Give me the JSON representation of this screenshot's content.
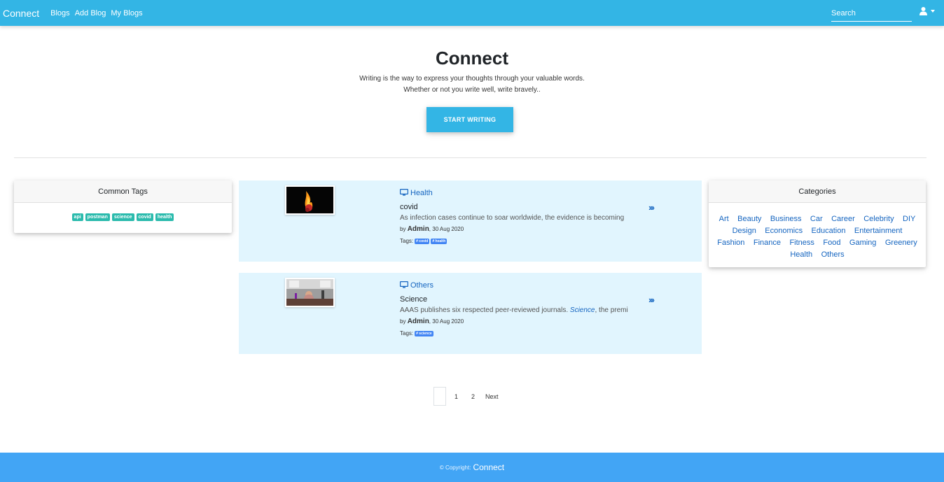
{
  "navbar": {
    "brand": "Connect",
    "links": [
      "Blogs",
      "Add Blog",
      "My Blogs"
    ],
    "search_placeholder": "Search",
    "user_icon": "user-icon",
    "bg_color": "#33b5e5"
  },
  "hero": {
    "title": "Connect",
    "line1": "Writing is the way to express your thoughts through your valuable words.",
    "line2": "Whether or not you write well, write bravely..",
    "button": "START WRITING"
  },
  "common_tags": {
    "header": "Common Tags",
    "tags": [
      "api",
      "postman",
      "science",
      "covid",
      "health"
    ]
  },
  "categories": {
    "header": "Categories",
    "items": [
      "Art",
      "Beauty",
      "Business",
      "Car",
      "Career",
      "Celebrity",
      "DIY",
      "Design",
      "Economics",
      "Education",
      "Entertainment",
      "Fashion",
      "Finance",
      "Fitness",
      "Food",
      "Gaming",
      "Greenery",
      "Health",
      "Others"
    ]
  },
  "blogs": [
    {
      "category": "Health",
      "title": "covid",
      "excerpt": "As infection cases continue to soar worldwide, the evidence is becoming",
      "by": "by",
      "author": "Admin",
      "date": ", 30 Aug 2020",
      "tags_label": "Tags:",
      "tags": [
        "# covid",
        "# health"
      ]
    },
    {
      "category": "Others",
      "title": "Science",
      "excerpt_pre": "AAAS publishes six respected peer-reviewed journals. ",
      "excerpt_em": "Science",
      "excerpt_post": ", the premi",
      "by": "by",
      "author": "Admin",
      "date": ", 30 Aug 2020",
      "tags_label": "Tags:",
      "tags": [
        "# science"
      ]
    }
  ],
  "pagination": {
    "pages": [
      "1",
      "2"
    ],
    "next": "Next"
  },
  "footer": {
    "copyright": "© Copyright:",
    "brand": "Connect"
  }
}
